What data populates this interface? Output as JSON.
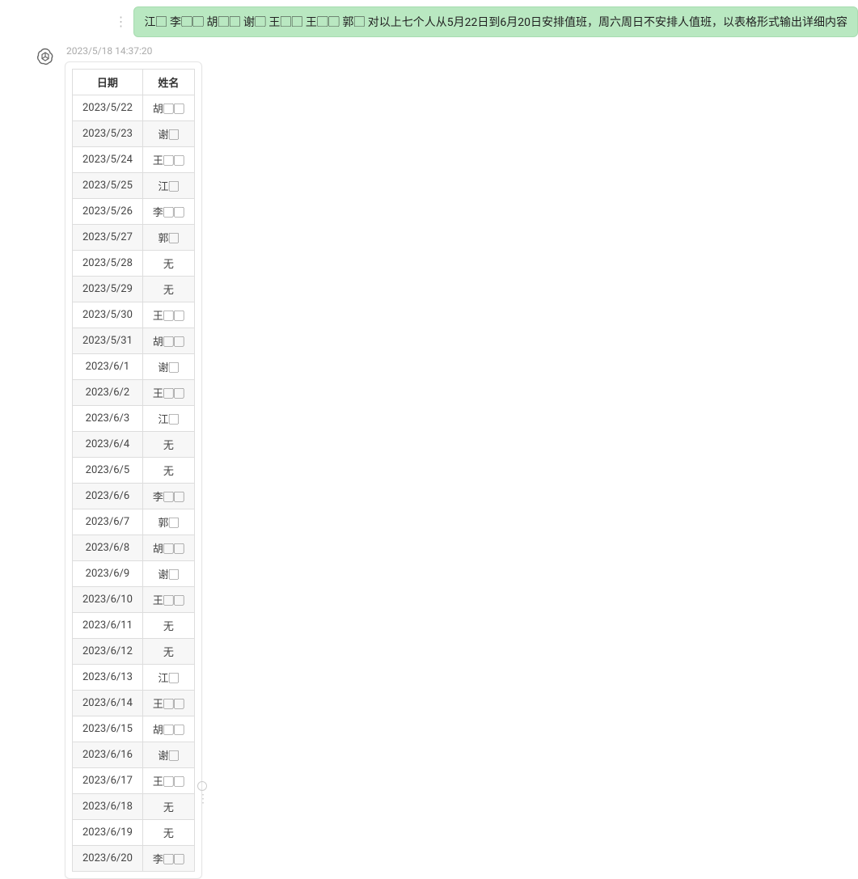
{
  "user_message": {
    "text": "江▢ 李▢▢ 胡▢▢ 谢▢ 王▢▢ 王▢▢ 郭▢ 对以上七个人从5月22日到6月20日安排值班，周六周日不安排人值班，以表格形式输出详细内容"
  },
  "assistant": {
    "timestamp": "2023/5/18 14:37:20",
    "table": {
      "headers": {
        "date": "日期",
        "name": "姓名"
      },
      "rows": [
        {
          "date": "2023/5/22",
          "name": "胡▢▢"
        },
        {
          "date": "2023/5/23",
          "name": "谢▢"
        },
        {
          "date": "2023/5/24",
          "name": "王▢▢"
        },
        {
          "date": "2023/5/25",
          "name": "江▢"
        },
        {
          "date": "2023/5/26",
          "name": "李▢▢"
        },
        {
          "date": "2023/5/27",
          "name": "郭▢"
        },
        {
          "date": "2023/5/28",
          "name": "无"
        },
        {
          "date": "2023/5/29",
          "name": "无"
        },
        {
          "date": "2023/5/30",
          "name": "王▢▢"
        },
        {
          "date": "2023/5/31",
          "name": "胡▢▢"
        },
        {
          "date": "2023/6/1",
          "name": "谢▢"
        },
        {
          "date": "2023/6/2",
          "name": "王▢▢"
        },
        {
          "date": "2023/6/3",
          "name": "江▢"
        },
        {
          "date": "2023/6/4",
          "name": "无"
        },
        {
          "date": "2023/6/5",
          "name": "无"
        },
        {
          "date": "2023/6/6",
          "name": "李▢▢"
        },
        {
          "date": "2023/6/7",
          "name": "郭▢"
        },
        {
          "date": "2023/6/8",
          "name": "胡▢▢"
        },
        {
          "date": "2023/6/9",
          "name": "谢▢"
        },
        {
          "date": "2023/6/10",
          "name": "王▢▢"
        },
        {
          "date": "2023/6/11",
          "name": "无"
        },
        {
          "date": "2023/6/12",
          "name": "无"
        },
        {
          "date": "2023/6/13",
          "name": "江▢"
        },
        {
          "date": "2023/6/14",
          "name": "王▢▢"
        },
        {
          "date": "2023/6/15",
          "name": "胡▢▢"
        },
        {
          "date": "2023/6/16",
          "name": "谢▢"
        },
        {
          "date": "2023/6/17",
          "name": "王▢▢"
        },
        {
          "date": "2023/6/18",
          "name": "无"
        },
        {
          "date": "2023/6/19",
          "name": "无"
        },
        {
          "date": "2023/6/20",
          "name": "李▢▢"
        }
      ]
    }
  }
}
